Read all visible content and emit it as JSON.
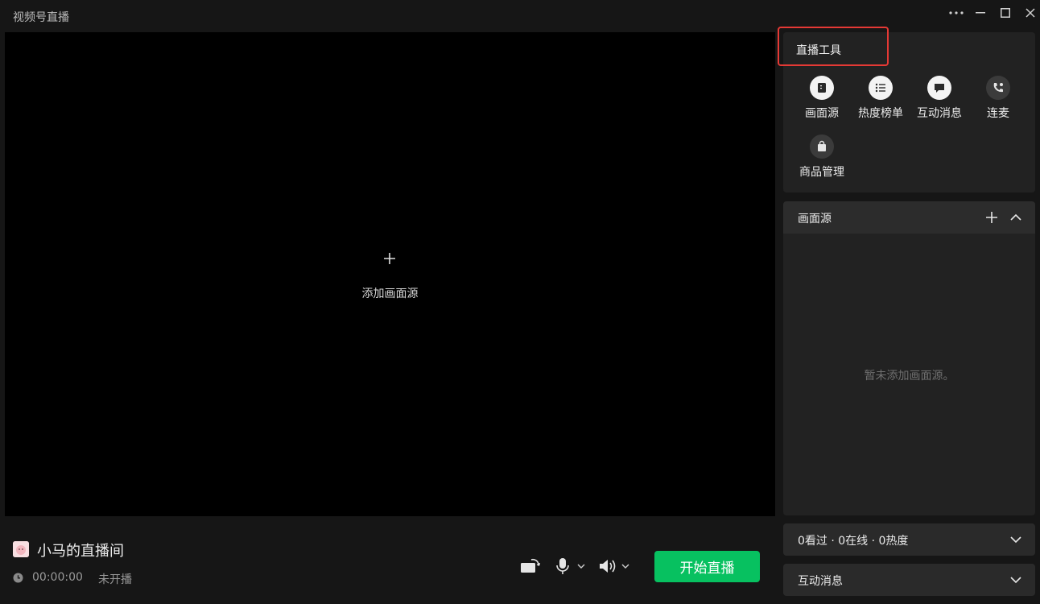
{
  "window": {
    "title": "视频号直播",
    "controls": [
      "more-icon",
      "minimize-icon",
      "maximize-icon",
      "close-icon"
    ]
  },
  "preview": {
    "add_source_label": "添加画面源"
  },
  "room": {
    "name": "小马的直播间",
    "timer": "00:00:00",
    "status": "未开播"
  },
  "controls": {
    "rotate_icon": "rotate-icon",
    "mic_icon": "microphone-icon",
    "speaker_icon": "speaker-icon",
    "start_label": "开始直播"
  },
  "tools": {
    "title": "直播工具",
    "items": [
      {
        "label": "画面源",
        "icon": "source-icon"
      },
      {
        "label": "热度榜单",
        "icon": "list-icon"
      },
      {
        "label": "互动消息",
        "icon": "chat-icon"
      },
      {
        "label": "连麦",
        "icon": "phone-icon"
      },
      {
        "label": "商品管理",
        "icon": "bag-icon"
      }
    ]
  },
  "source_panel": {
    "title": "画面源",
    "empty_text": "暂未添加画面源。"
  },
  "stats_panel": {
    "text": "0看过 · 0在线 · 0热度"
  },
  "messages_panel": {
    "title": "互动消息"
  },
  "colors": {
    "accent_green": "#07c160",
    "highlight_red": "#e53935",
    "background": "#161616",
    "panel": "#222222"
  }
}
